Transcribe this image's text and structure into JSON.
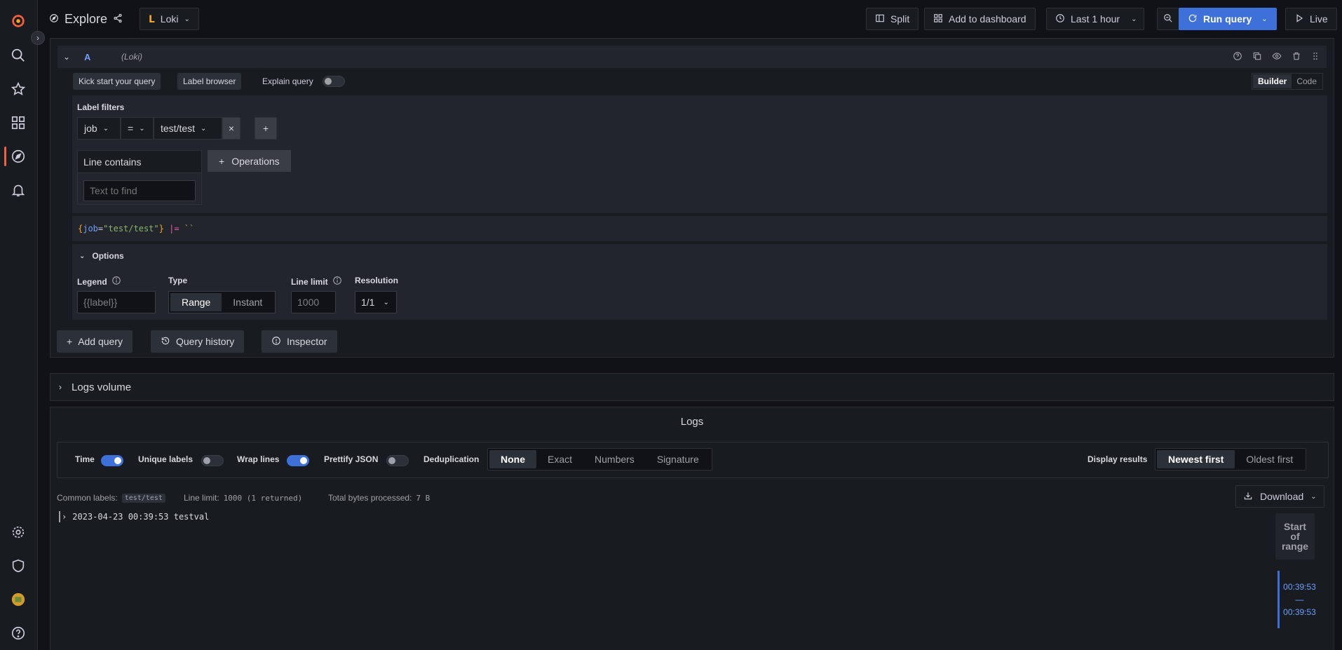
{
  "sidebar": {
    "items": [
      "grafana-logo",
      "search",
      "starred",
      "dashboards",
      "explore",
      "alerting",
      "configuration",
      "server-admin",
      "profile",
      "help"
    ]
  },
  "header": {
    "title": "Explore",
    "datasource": "Loki",
    "split_label": "Split",
    "add_dashboard_label": "Add to dashboard",
    "time_range": "Last 1 hour",
    "run_query_label": "Run query",
    "live_label": "Live"
  },
  "query": {
    "ref_id": "A",
    "datasource_hint": "(Loki)",
    "kickstart_label": "Kick start your query",
    "label_browser_label": "Label browser",
    "explain_label": "Explain query",
    "mode_builder": "Builder",
    "mode_code": "Code",
    "label_filters_title": "Label filters",
    "filter": {
      "label": "job",
      "op": "=",
      "value": "test/test",
      "remove": "×",
      "add": "+"
    },
    "line_contains": {
      "title": "Line contains",
      "placeholder": "Text to find"
    },
    "operations_label": "Operations",
    "expression": {
      "open": "{",
      "key": "job",
      "eq": "=",
      "value": "\"test/test\"",
      "close": "}",
      "pipe": "|=",
      "literal": "``"
    },
    "options": {
      "title": "Options",
      "legend_label": "Legend",
      "legend_placeholder": "{{label}}",
      "type_label": "Type",
      "type_range": "Range",
      "type_instant": "Instant",
      "line_limit_label": "Line limit",
      "line_limit_placeholder": "1000",
      "resolution_label": "Resolution",
      "resolution_value": "1/1"
    },
    "add_query_label": "Add query",
    "query_history_label": "Query history",
    "inspector_label": "Inspector"
  },
  "logs_volume": {
    "title": "Logs volume"
  },
  "logs": {
    "title": "Logs",
    "time_label": "Time",
    "unique_labels_label": "Unique labels",
    "wrap_lines_label": "Wrap lines",
    "prettify_label": "Prettify JSON",
    "dedup_label": "Deduplication",
    "dedup_options": [
      "None",
      "Exact",
      "Numbers",
      "Signature"
    ],
    "display_results_label": "Display results",
    "order_newest": "Newest first",
    "order_oldest": "Oldest first",
    "common_labels_label": "Common labels:",
    "common_labels_value": "test/test",
    "line_limit_label": "Line limit:",
    "line_limit_value": "1000 (1 returned)",
    "bytes_label": "Total bytes processed:",
    "bytes_value": "7 B",
    "download_label": "Download",
    "rows": [
      {
        "line": "2023-04-23 00:39:53 testval"
      }
    ],
    "range_start": "Start of range",
    "range_from": "00:39:53",
    "range_sep": "—",
    "range_to": "00:39:53"
  },
  "colors": {
    "accent": "#3d71d9",
    "brand": "#f55f3e",
    "bg": "#111217",
    "panel": "#181b1f"
  }
}
